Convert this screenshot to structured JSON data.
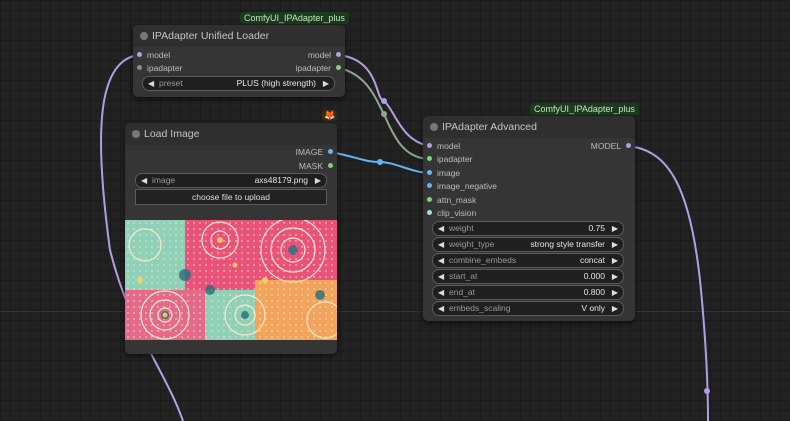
{
  "colors": {
    "canvas": "#222222",
    "node_bg": "#353535",
    "wire_model": "#b49ee3",
    "wire_image": "#64b5f6",
    "wire_ipadapter": "#8fa890",
    "pin_green": "#7ed37e",
    "pin_blue": "#64b5f6",
    "pin_purple": "#b49ee3"
  },
  "loader": {
    "badge": "ComfyUI_IPAdapter_plus",
    "title": "IPAdapter Unified Loader",
    "inputs": {
      "model": "model",
      "ipadapter": "ipadapter"
    },
    "outputs": {
      "model": "model",
      "ipadapter": "ipadapter"
    },
    "preset": {
      "name": "preset",
      "value": "PLUS (high strength)"
    }
  },
  "load_image": {
    "badge_icon": "fox-icon",
    "title": "Load Image",
    "outputs": {
      "image": "IMAGE",
      "mask": "MASK"
    },
    "image_widget": {
      "name": "image",
      "value": "axs48179.png"
    },
    "upload_button": "choose file to upload",
    "preview_icon": "mandala-pattern-image"
  },
  "advanced": {
    "badge": "ComfyUI_IPAdapter_plus",
    "title": "IPAdapter Advanced",
    "output": "MODEL",
    "inputs": [
      "model",
      "ipadapter",
      "image",
      "image_negative",
      "attn_mask",
      "clip_vision"
    ],
    "widgets": [
      {
        "name": "weight",
        "value": "0.75"
      },
      {
        "name": "weight_type",
        "value": "strong style transfer"
      },
      {
        "name": "combine_embeds",
        "value": "concat"
      },
      {
        "name": "start_at",
        "value": "0.000"
      },
      {
        "name": "end_at",
        "value": "0.800"
      },
      {
        "name": "embeds_scaling",
        "value": "V only"
      }
    ]
  }
}
